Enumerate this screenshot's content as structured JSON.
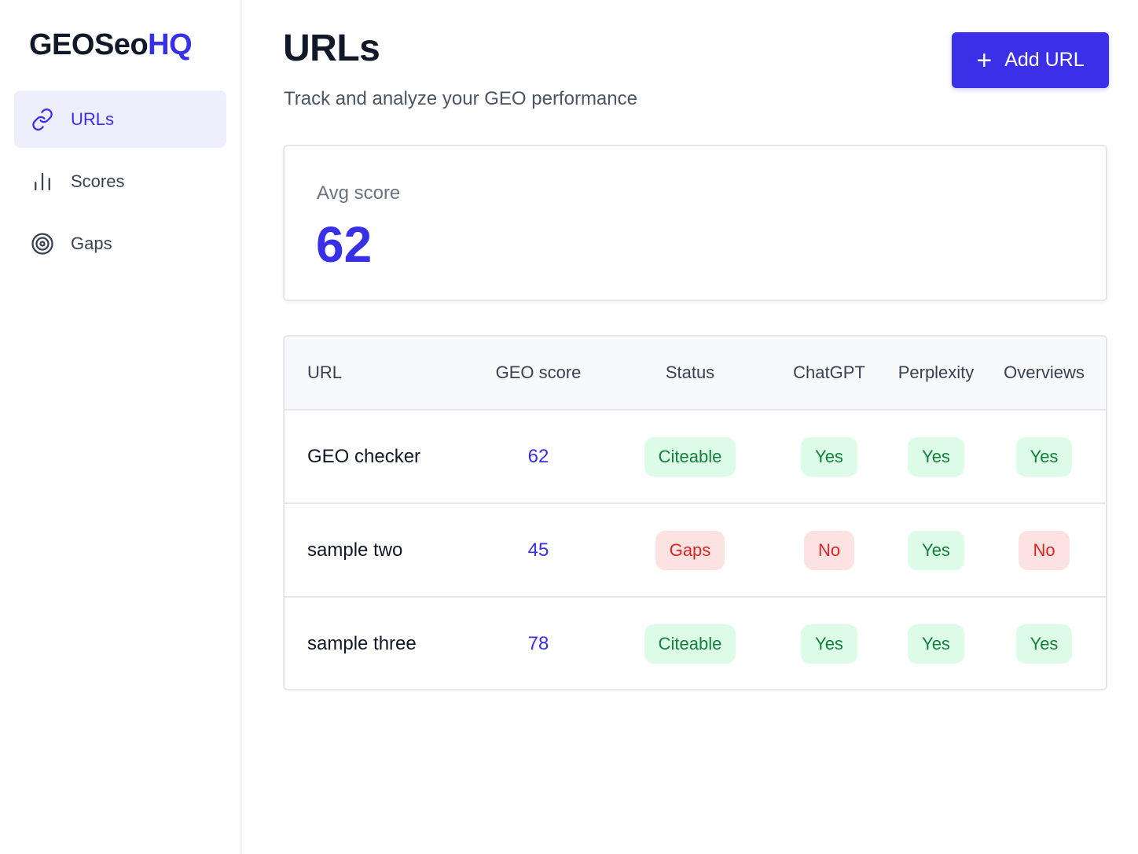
{
  "brand": {
    "name_main": "GEOSeo",
    "name_accent": "HQ",
    "accent_color": "#3730e8"
  },
  "sidebar": {
    "items": [
      {
        "label": "URLs",
        "icon": "link-icon",
        "active": true
      },
      {
        "label": "Scores",
        "icon": "bar-chart-icon",
        "active": false
      },
      {
        "label": "Gaps",
        "icon": "target-icon",
        "active": false
      }
    ]
  },
  "header": {
    "title": "URLs",
    "subtitle": "Track and analyze your GEO performance",
    "add_button_label": "Add URL"
  },
  "stats": {
    "avg_label": "Avg score",
    "avg_value": "62"
  },
  "table": {
    "columns": [
      "URL",
      "GEO score",
      "Status",
      "ChatGPT",
      "Perplexity",
      "Overviews"
    ],
    "rows": [
      {
        "url": "GEO checker",
        "score": "62",
        "status": "Citeable",
        "chatgpt": "Yes",
        "perplexity": "Yes",
        "overviews": "Yes"
      },
      {
        "url": "sample two",
        "score": "45",
        "status": "Gaps",
        "chatgpt": "No",
        "perplexity": "Yes",
        "overviews": "No"
      },
      {
        "url": "sample three",
        "score": "78",
        "status": "Citeable",
        "chatgpt": "Yes",
        "perplexity": "Yes",
        "overviews": "Yes"
      }
    ]
  },
  "colors": {
    "good_bg": "#dcfce7",
    "good_text": "#15803d",
    "bad_bg": "#fde2e2",
    "bad_text": "#dc2626",
    "primary": "#3b30e8"
  }
}
